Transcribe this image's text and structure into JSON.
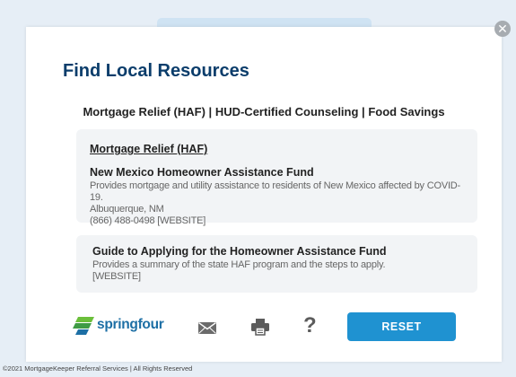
{
  "modal": {
    "close_label": "✕",
    "title": "Find Local Resources",
    "nav": {
      "mortgage": "Mortgage Relief (HAF)",
      "sep1": " | ",
      "counseling": "HUD-Certified Counseling",
      "sep2": " | ",
      "food": "Food Savings"
    }
  },
  "section": {
    "title": "Mortgage Relief (HAF)"
  },
  "resources": [
    {
      "name": "New Mexico Homeowner Assistance Fund",
      "description": "Provides mortgage and utility assistance to residents of New Mexico affected by COVID-19.",
      "location": "Albuquerque, NM",
      "phone": "(866) 488-0498",
      "website_label": "[WEBSITE]"
    },
    {
      "name": "Guide to Applying for the Homeowner Assistance Fund",
      "description": "Provides a summary of the state HAF program and the steps to apply.",
      "website_label": "[WEBSITE]"
    }
  ],
  "footer": {
    "logo_text": "springfour",
    "help_label": "?",
    "reset_label": "RESET"
  },
  "colors": {
    "title": "#0b3d6b",
    "reset_button": "#1f92d1",
    "logo_green": "#6bbf3b",
    "logo_blue": "#1d6fa5"
  },
  "icons": [
    "close-icon",
    "springfour-logo-icon",
    "mail-icon",
    "printer-icon",
    "help-icon"
  ],
  "copyright": "©2021 MortgageKeeper Referral Services | All Rights Reserved"
}
